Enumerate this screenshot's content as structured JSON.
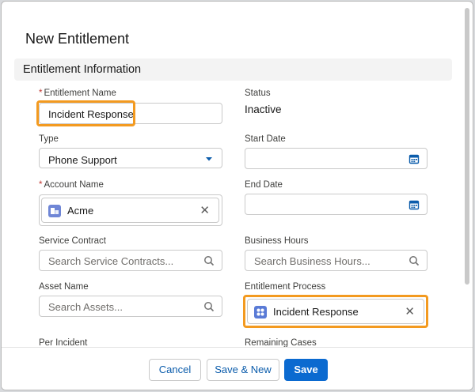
{
  "modal": {
    "title": "New Entitlement",
    "section_title": "Entitlement Information"
  },
  "fields": {
    "entitlement_name": {
      "label": "Entitlement Name",
      "required": "*",
      "value": "Incident Response"
    },
    "status": {
      "label": "Status",
      "value": "Inactive"
    },
    "type": {
      "label": "Type",
      "value": "Phone Support"
    },
    "start_date": {
      "label": "Start Date",
      "value": ""
    },
    "account_name": {
      "label": "Account Name",
      "required": "*",
      "value": "Acme"
    },
    "end_date": {
      "label": "End Date",
      "value": ""
    },
    "service_contract": {
      "label": "Service Contract",
      "placeholder": "Search Service Contracts..."
    },
    "business_hours": {
      "label": "Business Hours",
      "placeholder": "Search Business Hours..."
    },
    "asset_name": {
      "label": "Asset Name",
      "placeholder": "Search Assets..."
    },
    "entitlement_process": {
      "label": "Entitlement Process",
      "value": "Incident Response"
    },
    "per_incident": {
      "label": "Per Incident"
    },
    "remaining_cases": {
      "label": "Remaining Cases"
    }
  },
  "footer": {
    "cancel": "Cancel",
    "save_new": "Save & New",
    "save": "Save"
  },
  "icons": {
    "account": "account-record-icon",
    "process": "entitlement-process-record-icon",
    "calendar": "calendar-icon",
    "search": "search-icon",
    "clear": "clear-icon",
    "dropdown": "chevron-down-icon"
  },
  "colors": {
    "highlight": "#f39a20",
    "brand_button": "#0b6ad0",
    "required": "#c23934",
    "account_icon": "#6f86d6",
    "process_icon": "#5a7bd6"
  }
}
